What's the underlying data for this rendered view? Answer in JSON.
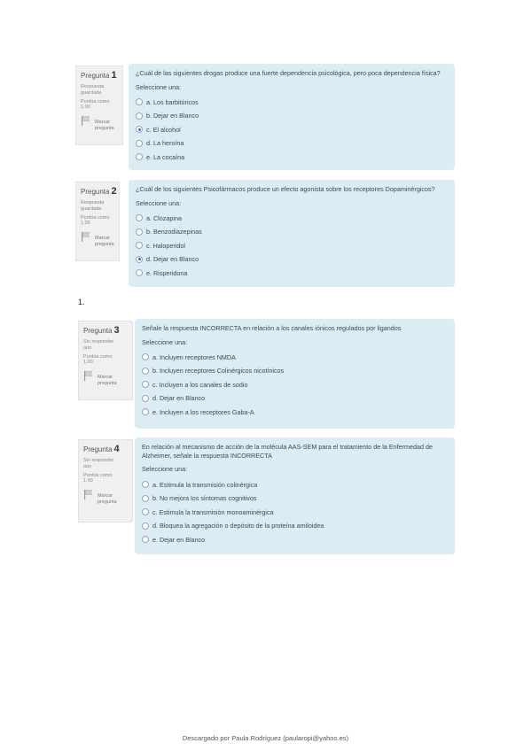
{
  "questions": [
    {
      "label": "Pregunta",
      "number": "1",
      "status": [
        "Respuesta",
        "guardada"
      ],
      "score": [
        "Puntúa como",
        "1,00"
      ],
      "flag": [
        "Marcar",
        "pregunta"
      ],
      "text": "¿Cuál de las siguientes drogas produce una fuerte dependencia psicológica, pero poca dependencia física?",
      "prompt": "Seleccione una:",
      "options": [
        "a. Los barbitúricos",
        "b. Dejar en Blanco",
        "c. El alcohol",
        "d. La heroína",
        "e. La cocaína"
      ],
      "selected": 2
    },
    {
      "label": "Pregunta",
      "number": "2",
      "status": [
        "Respuesta",
        "guardada"
      ],
      "score": [
        "Puntúa como",
        "1,00"
      ],
      "flag": [
        "Marcar",
        "pregunta"
      ],
      "text": "¿Cuál de los siguientes Psicofármacos produce un efecto agonista sobre los receptores Dopaminérgicos?",
      "prompt": "Seleccione una:",
      "options": [
        "a. Clozapina",
        "b. Benzodiazepinas",
        "c. Haloperidol",
        "d. Dejar en Blanco",
        "e. Risperidona"
      ],
      "selected": 3
    },
    {
      "label": "Pregunta",
      "number": "3",
      "status": [
        "Sin responder",
        "aún"
      ],
      "score": [
        "Puntúa como",
        "1,00"
      ],
      "flag": [
        "Marcar",
        "pregunta"
      ],
      "text": "Señale la respuesta INCORRECTA en relación a los canales iónicos regulados por ligandos",
      "prompt": "Seleccione una:",
      "options": [
        "a. Incluyen receptores NMDA",
        "b. Incluyen receptores Colinérgicos nicotínicos",
        "c. Incluyen a los canales de sodio",
        "d. Dejar en Blanco",
        "e. Incluyen a los receptores Gaba-A"
      ],
      "selected": -1
    },
    {
      "label": "Pregunta",
      "number": "4",
      "status": [
        "Sin responder",
        "aún"
      ],
      "score": [
        "Puntúa como",
        "1,00"
      ],
      "flag": [
        "Marcar",
        "pregunta"
      ],
      "text": "En relación al mecanismo de acción de la molécula AAS-SEM para el tratamiento de la Enfermedad de Alzheimer, señale la respuesta INCORRECTA",
      "prompt": "Seleccione una:",
      "options": [
        "a. Estimula la transmisión colinérgica",
        "b. No mejora los síntomas cognitivos",
        "c. Estimula la transmisión monoaminérgica",
        "d. Bloquea la agregación o depósito de la proteína amiloidea",
        "e. Dejar en Blanco"
      ],
      "selected": -1
    }
  ],
  "divider_label": "1.",
  "footer": "Descargado por Paula Rodríguez (paularopi@yahoo.es)"
}
